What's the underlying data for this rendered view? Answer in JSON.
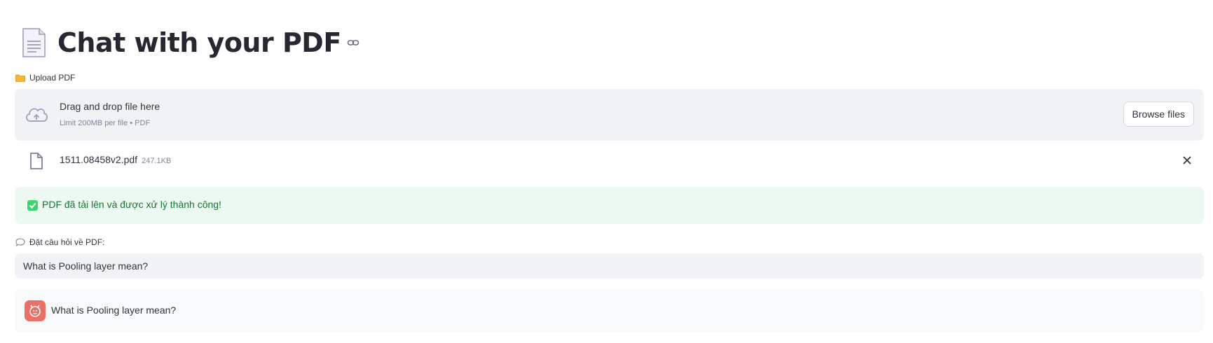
{
  "header": {
    "title": "Chat with your PDF",
    "title_icon": "document-icon",
    "anchor_icon": "link-icon"
  },
  "uploader": {
    "label": "Upload PDF",
    "label_icon": "folder-icon",
    "dropzone_title": "Drag and drop file here",
    "dropzone_subtitle": "Limit 200MB per file • PDF",
    "browse_label": "Browse files"
  },
  "uploaded_file": {
    "name": "1511.08458v2.pdf",
    "size": "247.1KB"
  },
  "alert": {
    "text": "PDF đã tải lên và được xử lý thành công!",
    "color": "#177233",
    "background": "#edf9f0"
  },
  "question": {
    "label": "Đặt câu hỏi về PDF:",
    "label_icon": "speech-bubble-icon",
    "value": "What is Pooling layer mean?"
  },
  "chat": {
    "messages": [
      {
        "role": "user",
        "text": "What is Pooling layer mean?",
        "avatar_color": "#ea6f67"
      }
    ]
  },
  "colors": {
    "accent": "#ff4b4b",
    "panel": "#f0f2f6",
    "text": "#31333f"
  }
}
